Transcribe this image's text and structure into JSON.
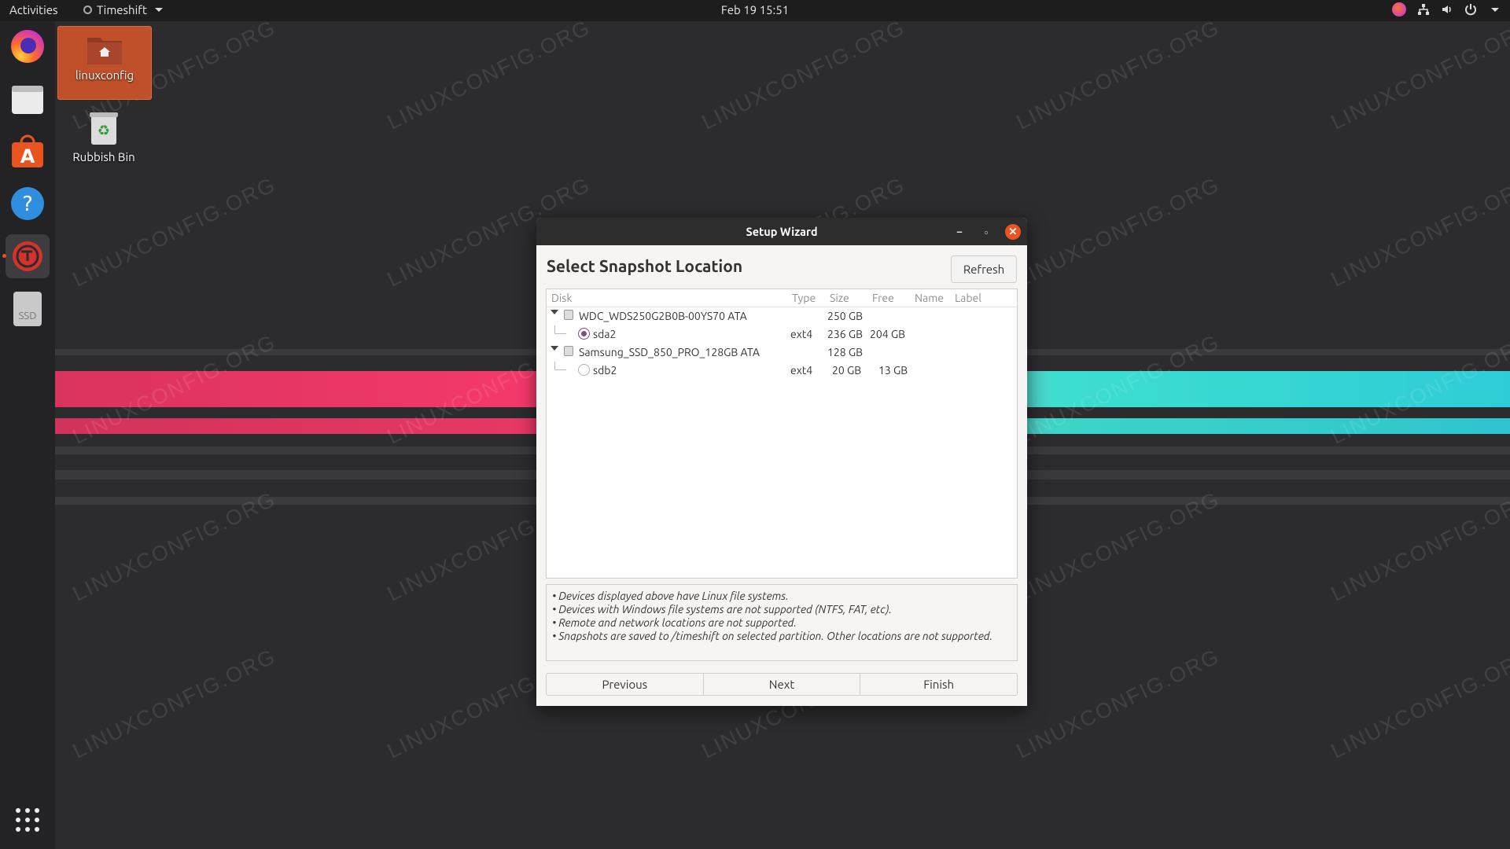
{
  "topbar": {
    "activities": "Activities",
    "app_name": "Timeshift",
    "clock": "Feb 19  15:51"
  },
  "dock": {
    "items": [
      {
        "name": "firefox"
      },
      {
        "name": "files"
      },
      {
        "name": "ubuntu-software"
      },
      {
        "name": "help"
      },
      {
        "name": "timeshift"
      },
      {
        "name": "ssd-drive",
        "label": "SSD"
      },
      {
        "name": "show-applications"
      }
    ]
  },
  "desktop": {
    "icons": [
      {
        "label": "linuxconfig"
      },
      {
        "label": "Rubbish Bin"
      }
    ]
  },
  "watermark": "LINUXCONFIG.ORG",
  "dialog": {
    "title": "Setup Wizard",
    "heading": "Select Snapshot Location",
    "refresh_label": "Refresh",
    "columns": [
      "Disk",
      "Type",
      "Size",
      "Free",
      "Name",
      "Label"
    ],
    "disks": [
      {
        "name": "WDC_WDS250G2B0B-00YS70 ATA",
        "size": "250 GB",
        "partitions": [
          {
            "name": "sda2",
            "type": "ext4",
            "size": "236 GB",
            "free": "204 GB",
            "selected": true
          }
        ]
      },
      {
        "name": "Samsung_SSD_850_PRO_128GB ATA",
        "size": "128 GB",
        "partitions": [
          {
            "name": "sdb2",
            "type": "ext4",
            "size": "20 GB",
            "free": "13 GB",
            "selected": false
          }
        ]
      }
    ],
    "notes": [
      "• Devices displayed above have Linux file systems.",
      "• Devices with Windows file systems are not supported (NTFS, FAT, etc).",
      "• Remote and network locations are not supported.",
      "• Snapshots are saved to /timeshift on selected partition. Other locations are not supported."
    ],
    "buttons": {
      "previous": "Previous",
      "next": "Next",
      "finish": "Finish"
    }
  },
  "colors": {
    "accent": "#e95420",
    "radio_selected": "#7d4d8f",
    "stripe_pink": "#ff3a6e",
    "stripe_cyan": "#3ee8e0"
  }
}
